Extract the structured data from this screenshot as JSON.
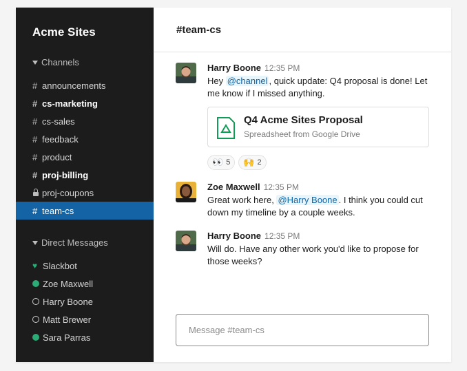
{
  "workspace": "Acme Sites",
  "channels_section": "Channels",
  "channels": [
    {
      "label": "announcements",
      "bold": false,
      "private": false,
      "active": false
    },
    {
      "label": "cs-marketing",
      "bold": true,
      "private": false,
      "active": false
    },
    {
      "label": "cs-sales",
      "bold": false,
      "private": false,
      "active": false
    },
    {
      "label": "feedback",
      "bold": false,
      "private": false,
      "active": false
    },
    {
      "label": "product",
      "bold": false,
      "private": false,
      "active": false
    },
    {
      "label": "proj-billing",
      "bold": true,
      "private": false,
      "active": false
    },
    {
      "label": "proj-coupons",
      "bold": false,
      "private": true,
      "active": false
    },
    {
      "label": "team-cs",
      "bold": false,
      "private": false,
      "active": true
    }
  ],
  "dm_section": "Direct Messages",
  "direct_messages": [
    {
      "label": "Slackbot",
      "status": "heart"
    },
    {
      "label": "Zoe Maxwell",
      "status": "online"
    },
    {
      "label": "Harry Boone",
      "status": "away"
    },
    {
      "label": "Matt Brewer",
      "status": "away"
    },
    {
      "label": "Sara Parras",
      "status": "online"
    }
  ],
  "channel_header": "#team-cs",
  "messages": [
    {
      "author": "Harry Boone",
      "time": "12:35 PM",
      "text_before": "Hey ",
      "mention": "@channel",
      "text_after": ", quick update: Q4 proposal is done! Let me know if I missed anything.",
      "attachment": {
        "title": "Q4 Acme Sites Proposal",
        "subtitle": "Spreadsheet from Google Drive"
      },
      "reactions": [
        {
          "emoji": "👀",
          "count": "5"
        },
        {
          "emoji": "🙌",
          "count": "2"
        }
      ]
    },
    {
      "author": "Zoe Maxwell",
      "time": "12:35 PM",
      "text_before": "Great work here, ",
      "mention": "@Harry Boone",
      "text_after": ". I think you could cut down my timeline by a couple weeks."
    },
    {
      "author": "Harry Boone",
      "time": "12:35 PM",
      "text": "Will do. Have any other work you'd like to propose for those weeks?"
    }
  ],
  "composer": {
    "placeholder": "Message #team-cs"
  },
  "colors": {
    "sidebar": "#1c1c1c",
    "active_channel": "#1464a5",
    "presence": "#2bac76",
    "mention": "#1264a3",
    "drive_icon": "#0f9d58"
  },
  "icons": {
    "channel": "hash-icon",
    "private": "lock-icon",
    "section": "caret-down-icon",
    "slackbot": "heart-icon",
    "attachment": "google-drive-icon"
  }
}
